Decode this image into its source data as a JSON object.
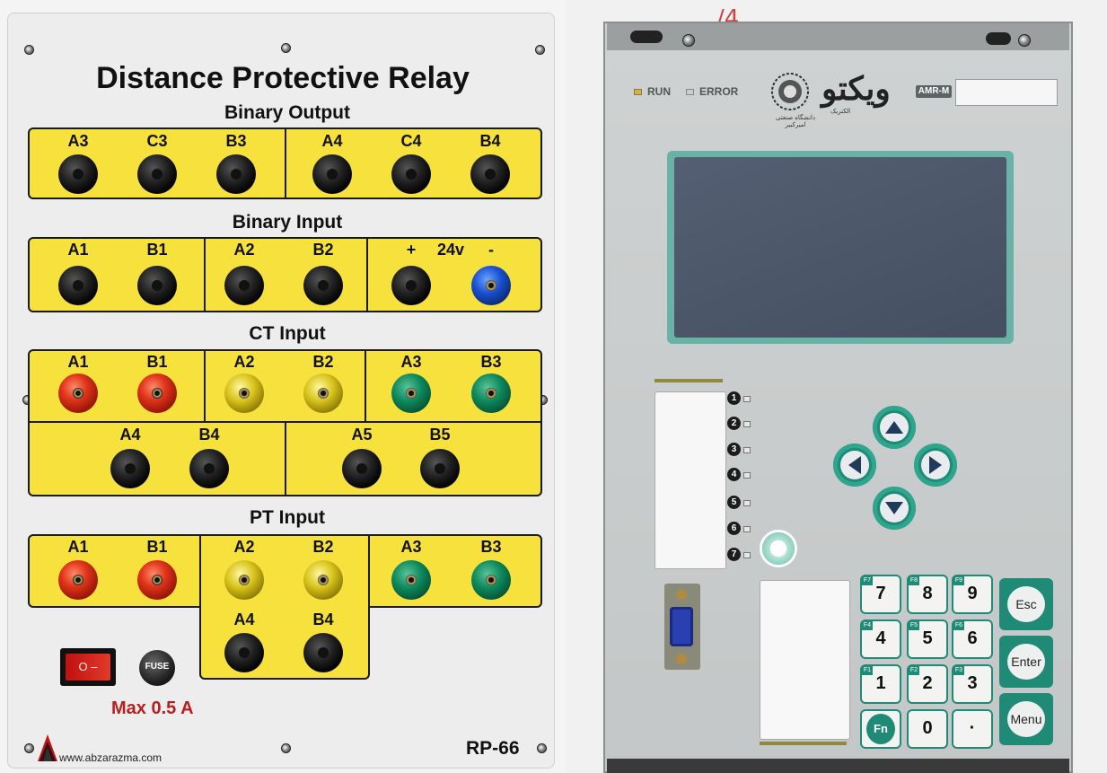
{
  "left_panel": {
    "title": "Distance Protective Relay",
    "binary_output": {
      "title": "Binary Output",
      "labels": [
        "A3",
        "C3",
        "B3",
        "A4",
        "C4",
        "B4"
      ]
    },
    "binary_input": {
      "title": "Binary Input",
      "labels": [
        "A1",
        "B1",
        "A2",
        "B2",
        "+",
        "24v",
        "-"
      ]
    },
    "ct_input": {
      "title": "CT Input",
      "labels": [
        "A1",
        "B1",
        "A2",
        "B2",
        "A3",
        "B3",
        "A4",
        "B4",
        "A5",
        "B5"
      ]
    },
    "pt_input": {
      "title": "PT Input",
      "labels": [
        "A1",
        "B1",
        "A2",
        "B2",
        "A3",
        "B3",
        "A4",
        "B4"
      ]
    },
    "power_switch": "O  –",
    "fuse_label": "FUSE",
    "max_current": "Max 0.5 A",
    "website": "www.abzarazma.com",
    "model": "RP-66",
    "colors": {
      "panel": "#ededed",
      "terminal_box": "#f7e23d",
      "accent_red": "#b81e1e"
    }
  },
  "device": {
    "leds": {
      "run": "RUN",
      "error": "ERROR"
    },
    "university_text": "دانشگاه صنعتی امیرکبیر",
    "brand": "ویکتو",
    "brand_sub": "الکتریک",
    "model_badge": "AMR-M",
    "side_leds": [
      "1",
      "2",
      "3",
      "4",
      "5",
      "6",
      "7"
    ],
    "keypad": {
      "rows": [
        [
          {
            "f": "F7",
            "k": "7"
          },
          {
            "f": "F8",
            "k": "8"
          },
          {
            "f": "F9",
            "k": "9"
          }
        ],
        [
          {
            "f": "F4",
            "k": "4"
          },
          {
            "f": "F5",
            "k": "5"
          },
          {
            "f": "F6",
            "k": "6"
          }
        ],
        [
          {
            "f": "F1",
            "k": "1"
          },
          {
            "f": "F2",
            "k": "2"
          },
          {
            "f": "F3",
            "k": "3"
          }
        ],
        [
          {
            "f": "",
            "k": "Fn"
          },
          {
            "f": "",
            "k": "0"
          },
          {
            "f": "",
            "k": "·"
          }
        ]
      ],
      "esc": "Esc",
      "enter": "Enter",
      "menu": "Menu"
    },
    "nav_icons": [
      "up-arrow-icon",
      "left-arrow-icon",
      "right-arrow-icon",
      "down-arrow-icon"
    ],
    "colors": {
      "accent": "#1f8a76",
      "lcd_bezel": "#69b3a6",
      "lcd": "#4d576b",
      "body": "#c9cccc"
    }
  },
  "scribble": "/4"
}
